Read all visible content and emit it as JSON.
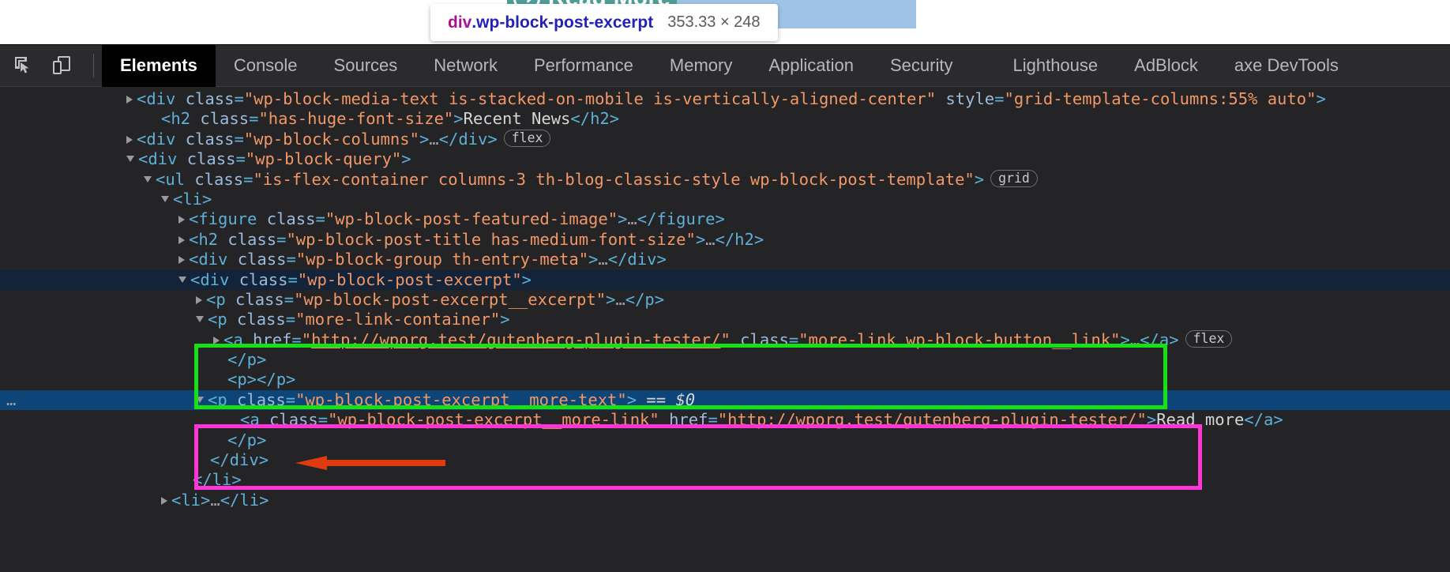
{
  "page_behind": {
    "read_more_button": "Read More",
    "read_more_icon": "arrow-circle-right-icon",
    "teal_color": "#4e9e98",
    "highlight_color": "#9ec3e6"
  },
  "tooltip": {
    "tag": "div",
    "class": ".wp-block-post-excerpt",
    "dimensions": "353.33 × 248"
  },
  "toolbar": {
    "inspect_icon": "inspect-element-icon",
    "device_icon": "device-toolbar-icon",
    "tabs": [
      {
        "label": "Elements",
        "active": true
      },
      {
        "label": "Console",
        "active": false
      },
      {
        "label": "Sources",
        "active": false
      },
      {
        "label": "Network",
        "active": false
      },
      {
        "label": "Performance",
        "active": false
      },
      {
        "label": "Memory",
        "active": false
      },
      {
        "label": "Application",
        "active": false
      },
      {
        "label": "Security",
        "active": false
      },
      {
        "label": "Lighthouse",
        "active": false
      },
      {
        "label": "AdBlock",
        "active": false
      },
      {
        "label": "axe DevTools",
        "active": false
      }
    ]
  },
  "dom": {
    "rows": [
      {
        "id": "r1",
        "indent": 160,
        "marker": "closed",
        "parts": [
          {
            "c": "tg",
            "t": "<div "
          },
          {
            "c": "at",
            "t": "class"
          },
          {
            "c": "tg",
            "t": "="
          },
          {
            "c": "vl",
            "t": "\"wp-block-media-text is-stacked-on-mobile is-vertically-aligned-center\""
          },
          {
            "c": "tg",
            "t": " "
          },
          {
            "c": "at",
            "t": "style"
          },
          {
            "c": "tg",
            "t": "="
          },
          {
            "c": "vl",
            "t": "\"grid-template-columns:55% auto\""
          },
          {
            "c": "tg",
            "t": ">"
          }
        ]
      },
      {
        "id": "r2",
        "indent": 186,
        "marker": "none",
        "parts": [
          {
            "c": "tg",
            "t": "<h2 "
          },
          {
            "c": "at",
            "t": "class"
          },
          {
            "c": "tg",
            "t": "="
          },
          {
            "c": "vl",
            "t": "\"has-huge-font-size\""
          },
          {
            "c": "tg",
            "t": ">"
          },
          {
            "c": "tx",
            "t": "Recent News"
          },
          {
            "c": "tg",
            "t": "</h2>"
          }
        ]
      },
      {
        "id": "r3",
        "indent": 160,
        "marker": "closed",
        "badge": "flex",
        "parts": [
          {
            "c": "tg",
            "t": "<div "
          },
          {
            "c": "at",
            "t": "class"
          },
          {
            "c": "tg",
            "t": "="
          },
          {
            "c": "vl",
            "t": "\"wp-block-columns\""
          },
          {
            "c": "tg",
            "t": ">"
          },
          {
            "c": "ell",
            "t": "…"
          },
          {
            "c": "tg",
            "t": "</div>"
          }
        ]
      },
      {
        "id": "r4",
        "indent": 160,
        "marker": "open",
        "parts": [
          {
            "c": "tg",
            "t": "<div "
          },
          {
            "c": "at",
            "t": "class"
          },
          {
            "c": "tg",
            "t": "="
          },
          {
            "c": "vl",
            "t": "\"wp-block-query\""
          },
          {
            "c": "tg",
            "t": ">"
          }
        ]
      },
      {
        "id": "r5",
        "indent": 182,
        "marker": "open",
        "badge": "grid",
        "parts": [
          {
            "c": "tg",
            "t": "<ul "
          },
          {
            "c": "at",
            "t": "class"
          },
          {
            "c": "tg",
            "t": "="
          },
          {
            "c": "vl",
            "t": "\"is-flex-container columns-3 th-blog-classic-style wp-block-post-template\""
          },
          {
            "c": "tg",
            "t": ">"
          }
        ]
      },
      {
        "id": "r6",
        "indent": 204,
        "marker": "open",
        "parts": [
          {
            "c": "tg",
            "t": "<li>"
          }
        ]
      },
      {
        "id": "r7",
        "indent": 226,
        "marker": "closed",
        "parts": [
          {
            "c": "tg",
            "t": "<figure "
          },
          {
            "c": "at",
            "t": "class"
          },
          {
            "c": "tg",
            "t": "="
          },
          {
            "c": "vl",
            "t": "\"wp-block-post-featured-image\""
          },
          {
            "c": "tg",
            "t": ">"
          },
          {
            "c": "ell",
            "t": "…"
          },
          {
            "c": "tg",
            "t": "</figure>"
          }
        ]
      },
      {
        "id": "r8",
        "indent": 226,
        "marker": "closed",
        "parts": [
          {
            "c": "tg",
            "t": "<h2 "
          },
          {
            "c": "at",
            "t": "class"
          },
          {
            "c": "tg",
            "t": "="
          },
          {
            "c": "vl",
            "t": "\"wp-block-post-title has-medium-font-size\""
          },
          {
            "c": "tg",
            "t": ">"
          },
          {
            "c": "ell",
            "t": "…"
          },
          {
            "c": "tg",
            "t": "</h2>"
          }
        ]
      },
      {
        "id": "r9",
        "indent": 226,
        "marker": "closed",
        "parts": [
          {
            "c": "tg",
            "t": "<div "
          },
          {
            "c": "at",
            "t": "class"
          },
          {
            "c": "tg",
            "t": "="
          },
          {
            "c": "vl",
            "t": "\"wp-block-group th-entry-meta\""
          },
          {
            "c": "tg",
            "t": ">"
          },
          {
            "c": "ell",
            "t": "…"
          },
          {
            "c": "tg",
            "t": "</div>"
          }
        ]
      },
      {
        "id": "r10",
        "indent": 226,
        "marker": "open",
        "hl": "parent",
        "parts": [
          {
            "c": "tg",
            "t": "<div "
          },
          {
            "c": "at",
            "t": "class"
          },
          {
            "c": "tg",
            "t": "="
          },
          {
            "c": "vl",
            "t": "\"wp-block-post-excerpt\""
          },
          {
            "c": "tg",
            "t": ">"
          }
        ]
      },
      {
        "id": "r11",
        "indent": 248,
        "marker": "closed",
        "parts": [
          {
            "c": "tg",
            "t": "<p "
          },
          {
            "c": "at",
            "t": "class"
          },
          {
            "c": "tg",
            "t": "="
          },
          {
            "c": "vl",
            "t": "\"wp-block-post-excerpt__excerpt\""
          },
          {
            "c": "tg",
            "t": ">"
          },
          {
            "c": "ell",
            "t": "…"
          },
          {
            "c": "tg",
            "t": "</p>"
          }
        ]
      },
      {
        "id": "r12",
        "indent": 248,
        "marker": "open",
        "parts": [
          {
            "c": "tg",
            "t": "<p "
          },
          {
            "c": "at",
            "t": "class"
          },
          {
            "c": "tg",
            "t": "="
          },
          {
            "c": "vl",
            "t": "\"more-link-container\""
          },
          {
            "c": "tg",
            "t": ">"
          }
        ]
      },
      {
        "id": "r13",
        "indent": 270,
        "marker": "closed",
        "badge": "flex",
        "parts": [
          {
            "c": "tg",
            "t": "<a "
          },
          {
            "c": "at",
            "t": "href"
          },
          {
            "c": "tg",
            "t": "="
          },
          {
            "c": "vl",
            "t": "\""
          },
          {
            "c": "lnk",
            "t": "http://wporg.test/gutenberg-plugin-tester/"
          },
          {
            "c": "vl",
            "t": "\""
          },
          {
            "c": "tg",
            "t": " "
          },
          {
            "c": "at",
            "t": "class"
          },
          {
            "c": "tg",
            "t": "="
          },
          {
            "c": "vl",
            "t": "\"more-link wp-block-button__link\""
          },
          {
            "c": "tg",
            "t": ">"
          },
          {
            "c": "ell",
            "t": "…"
          },
          {
            "c": "tg",
            "t": "</a>"
          }
        ]
      },
      {
        "id": "r14",
        "indent": 270,
        "marker": "none",
        "parts": [
          {
            "c": "tg",
            "t": "</p>"
          }
        ]
      },
      {
        "id": "r15",
        "indent": 270,
        "marker": "none",
        "parts": [
          {
            "c": "tg",
            "t": "<p></p>"
          }
        ]
      },
      {
        "id": "r16",
        "indent": 248,
        "marker": "open",
        "hl": "sel",
        "dots": "…",
        "parts": [
          {
            "c": "tg",
            "t": "<p "
          },
          {
            "c": "at",
            "t": "class"
          },
          {
            "c": "tg",
            "t": "="
          },
          {
            "c": "vl",
            "t": "\"wp-block-post-excerpt__more-text\""
          },
          {
            "c": "tg",
            "t": "> "
          },
          {
            "c": "dollar",
            "t": "== $0"
          }
        ]
      },
      {
        "id": "r17",
        "indent": 286,
        "marker": "none",
        "parts": [
          {
            "c": "tg",
            "t": "<a "
          },
          {
            "c": "at",
            "t": "class"
          },
          {
            "c": "tg",
            "t": "="
          },
          {
            "c": "vl",
            "t": "\"wp-block-post-excerpt__more-link\""
          },
          {
            "c": "tg",
            "t": " "
          },
          {
            "c": "at",
            "t": "href"
          },
          {
            "c": "tg",
            "t": "="
          },
          {
            "c": "vl",
            "t": "\""
          },
          {
            "c": "lnk",
            "t": "http://wporg.test/gutenberg-plugin-tester/"
          },
          {
            "c": "vl",
            "t": "\""
          },
          {
            "c": "tg",
            "t": ">"
          },
          {
            "c": "tx",
            "t": "Read more"
          },
          {
            "c": "tg",
            "t": "</a>"
          }
        ]
      },
      {
        "id": "r18",
        "indent": 270,
        "marker": "none",
        "parts": [
          {
            "c": "tg",
            "t": "</p>"
          }
        ]
      },
      {
        "id": "r19",
        "indent": 248,
        "marker": "none",
        "parts": [
          {
            "c": "tg",
            "t": "</div>"
          }
        ]
      },
      {
        "id": "r20",
        "indent": 226,
        "marker": "none",
        "parts": [
          {
            "c": "tg",
            "t": "</li>"
          }
        ]
      },
      {
        "id": "r21",
        "indent": 204,
        "marker": "closed",
        "parts": [
          {
            "c": "tg",
            "t": "<li>"
          },
          {
            "c": "ell",
            "t": "…"
          },
          {
            "c": "tg",
            "t": "</li>"
          }
        ]
      }
    ]
  },
  "annotations": {
    "green_box_color": "#16e016",
    "pink_box_color": "#ff35d6",
    "arrow_color": "#e03a10",
    "arrow_label": "red-left-arrow"
  }
}
